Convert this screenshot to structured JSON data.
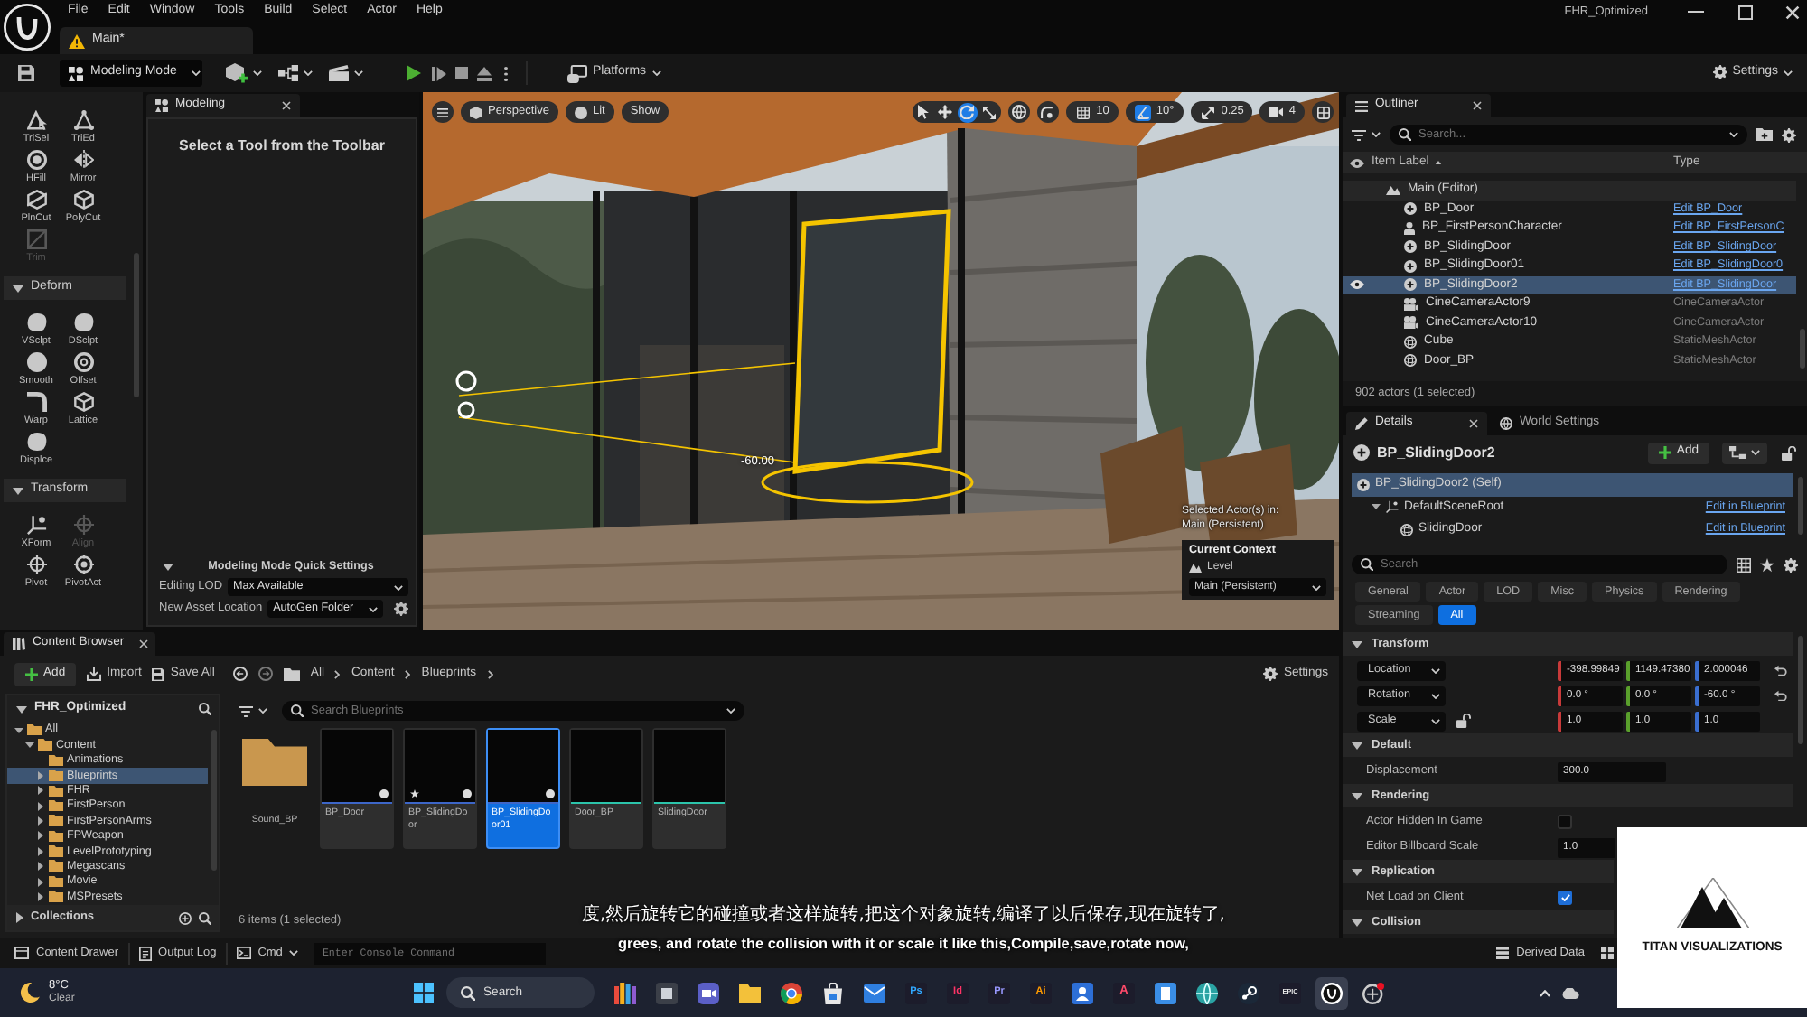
{
  "window": {
    "title": "FHR_Optimized"
  },
  "menu": [
    "File",
    "Edit",
    "Window",
    "Tools",
    "Build",
    "Select",
    "Actor",
    "Help"
  ],
  "level_tab": {
    "label": "Main*"
  },
  "toolbar": {
    "mode": "Modeling Mode",
    "platforms": "Platforms",
    "settings": "Settings"
  },
  "tool_palette": [
    {
      "items": [
        {
          "label": "TriSel",
          "disabled": false
        },
        {
          "label": "TriEd",
          "disabled": false
        },
        {
          "label": "HFill",
          "disabled": false
        },
        {
          "label": "Mirror",
          "disabled": false
        },
        {
          "label": "PlnCut",
          "disabled": false
        },
        {
          "label": "PolyCut",
          "disabled": false
        },
        {
          "label": "Trim",
          "disabled": true
        }
      ]
    },
    {
      "title": "Deform",
      "expanded": true,
      "items": [
        {
          "label": "VSclpt",
          "disabled": false
        },
        {
          "label": "DSclpt",
          "disabled": false
        },
        {
          "label": "Smooth",
          "disabled": false
        },
        {
          "label": "Offset",
          "disabled": false
        },
        {
          "label": "Warp",
          "disabled": false
        },
        {
          "label": "Lattice",
          "disabled": false
        },
        {
          "label": "Displce",
          "disabled": false
        }
      ]
    },
    {
      "title": "Transform",
      "expanded": true,
      "items": [
        {
          "label": "XForm",
          "disabled": false
        },
        {
          "label": "Align",
          "disabled": true
        },
        {
          "label": "Pivot",
          "disabled": false
        },
        {
          "label": "PivotAct",
          "disabled": false
        }
      ]
    }
  ],
  "modeling_panel": {
    "tab": "Modeling",
    "message": "Select a Tool from the Toolbar",
    "quick_settings": {
      "title": "Modeling Mode Quick Settings",
      "expanded": true,
      "fields": [
        {
          "label": "Editing LOD",
          "value": "Max Available"
        },
        {
          "label": "New Asset Location",
          "value": "AutoGen Folder"
        }
      ]
    }
  },
  "viewport": {
    "view_buttons": [
      "Perspective",
      "Lit",
      "Show"
    ],
    "transform_tools": [
      {
        "selected": false
      },
      {
        "selected": false
      },
      {
        "selected": true
      },
      {
        "selected": false
      }
    ],
    "snaps": [
      {
        "value": "10",
        "on": false
      },
      {
        "value": "10°",
        "on": true
      },
      {
        "value": "0.25",
        "on": false
      }
    ],
    "camera_speed": "4",
    "gizmo_reading": "-60.00",
    "context": {
      "selection_note": "Selected Actor(s) in:",
      "selection_level": "Main (Persistent)",
      "title": "Current Context",
      "level_label": "Level",
      "level": "Main (Persistent)"
    }
  },
  "outliner": {
    "tab": "Outliner",
    "search_placeholder": "Search...",
    "columns": [
      "Item Label",
      "Type"
    ],
    "tree": [
      {
        "label": "Main (Editor)",
        "selected": false,
        "children": [
          {
            "label": "BP_Door",
            "type": "Edit BP_Door",
            "kind": "blueprint",
            "selected": false
          },
          {
            "label": "BP_FirstPersonCharacter",
            "type": "Edit BP_FirstPersonC",
            "kind": "character",
            "selected": false
          },
          {
            "label": "BP_SlidingDoor",
            "type": "Edit BP_SlidingDoor",
            "kind": "blueprint",
            "selected": false
          },
          {
            "label": "BP_SlidingDoor01",
            "type": "Edit BP_SlidingDoor0",
            "kind": "blueprint",
            "selected": false
          },
          {
            "label": "BP_SlidingDoor2",
            "type": "Edit BP_SlidingDoor",
            "kind": "blueprint",
            "selected": true
          },
          {
            "label": "CineCameraActor9",
            "type": "CineCameraActor",
            "kind": "camera",
            "selected": false
          },
          {
            "label": "CineCameraActor10",
            "type": "CineCameraActor",
            "kind": "camera",
            "selected": false
          },
          {
            "label": "Cube",
            "type": "StaticMeshActor",
            "kind": "mesh",
            "selected": false
          },
          {
            "label": "Door_BP",
            "type": "StaticMeshActor",
            "kind": "mesh",
            "selected": false
          }
        ]
      }
    ],
    "footer": "902 actors (1 selected)"
  },
  "details": {
    "tabs": [
      {
        "label": "Details",
        "selected": true
      },
      {
        "label": "World Settings",
        "selected": false
      }
    ],
    "actor": "BP_SlidingDoor2",
    "add_button": "Add",
    "components": [
      {
        "label": "BP_SlidingDoor2 (Self)",
        "selected": true,
        "children": [
          {
            "label": "DefaultSceneRoot",
            "link": "Edit in Blueprint",
            "selected": false,
            "children": [
              {
                "label": "SlidingDoor",
                "link": "Edit in Blueprint",
                "selected": false
              }
            ]
          }
        ]
      }
    ],
    "search_placeholder": "Search",
    "filters": [
      {
        "label": "General",
        "selected": false
      },
      {
        "label": "Actor",
        "selected": false
      },
      {
        "label": "LOD",
        "selected": false
      },
      {
        "label": "Misc",
        "selected": false
      },
      {
        "label": "Physics",
        "selected": false
      },
      {
        "label": "Rendering",
        "selected": false
      },
      {
        "label": "Streaming",
        "selected": false
      },
      {
        "label": "All",
        "selected": true
      }
    ],
    "sections": [
      {
        "title": "Transform",
        "expanded": true,
        "rows": [
          {
            "kind": "vector",
            "label": "Location",
            "values": [
              "-398.99849",
              "1149.47380",
              "2.000046"
            ],
            "modified": true
          },
          {
            "kind": "vector",
            "label": "Rotation",
            "values": [
              "0.0 °",
              "0.0 °",
              "-60.0 °"
            ],
            "modified": true
          },
          {
            "kind": "scale",
            "label": "Scale",
            "values": [
              "1.0",
              "1.0",
              "1.0"
            ],
            "modified": false,
            "locked": false
          }
        ]
      },
      {
        "title": "Default",
        "expanded": true,
        "rows": [
          {
            "kind": "number",
            "label": "Displacement",
            "value": "300.0"
          }
        ]
      },
      {
        "title": "Rendering",
        "expanded": true,
        "rows": [
          {
            "kind": "checkbox",
            "label": "Actor Hidden In Game",
            "checked": false
          },
          {
            "kind": "number",
            "label": "Editor Billboard Scale",
            "value": "1.0"
          }
        ]
      },
      {
        "title": "Replication",
        "expanded": true,
        "rows": [
          {
            "kind": "checkbox",
            "label": "Net Load on Client",
            "checked": true
          }
        ]
      },
      {
        "title": "Collision",
        "expanded": true
      }
    ]
  },
  "content_browser": {
    "tab": "Content Browser",
    "buttons": [
      "Add",
      "Import",
      "Save All"
    ],
    "breadcrumbs": [
      "All",
      "Content",
      "Blueprints"
    ],
    "settings": "Settings",
    "tree_title": "FHR_Optimized",
    "folders": [
      {
        "label": "All",
        "expanded": true,
        "selected": false,
        "children": [
          {
            "label": "Content",
            "expanded": true,
            "selected": false,
            "children": [
              {
                "label": "Animations",
                "selected": false
              },
              {
                "label": "Blueprints",
                "expanded": false,
                "selected": true
              },
              {
                "label": "FHR",
                "expanded": false,
                "selected": false
              },
              {
                "label": "FirstPerson",
                "expanded": false,
                "selected": false
              },
              {
                "label": "FirstPersonArms",
                "expanded": false,
                "selected": false
              },
              {
                "label": "FPWeapon",
                "expanded": false,
                "selected": false
              },
              {
                "label": "LevelPrototyping",
                "expanded": false,
                "selected": false
              },
              {
                "label": "Megascans",
                "expanded": false,
                "selected": false
              },
              {
                "label": "Movie",
                "expanded": false,
                "selected": false
              },
              {
                "label": "MSPresets",
                "expanded": false,
                "selected": false
              }
            ]
          }
        ]
      }
    ],
    "collections": "Collections",
    "search_placeholder": "Search Blueprints",
    "assets": [
      {
        "name": "Sound_BP",
        "kind": "folder",
        "selected": false,
        "starred": false
      },
      {
        "name": "BP_Door",
        "kind": "blueprint",
        "selected": false,
        "starred": false
      },
      {
        "name": "BP_SlidingDoor",
        "kind": "blueprint",
        "selected": false,
        "starred": true
      },
      {
        "name": "BP_SlidingDoor01",
        "kind": "blueprint",
        "selected": true,
        "starred": false
      },
      {
        "name": "Door_BP",
        "kind": "mesh",
        "selected": false,
        "starred": false
      },
      {
        "name": "SlidingDoor",
        "kind": "mesh",
        "selected": false,
        "starred": false
      }
    ],
    "footer": "6 items (1 selected)"
  },
  "status_bar": {
    "items": [
      "Content Drawer",
      "Output Log"
    ],
    "cmd": "Cmd",
    "console_placeholder": "Enter Console Command",
    "derived_data": "Derived Data"
  },
  "taskbar": {
    "weather": {
      "temperature": "8°C",
      "condition": "Clear"
    },
    "search_placeholder": "Search",
    "apps": [
      {
        "kind": "pencils",
        "selected": false
      },
      {
        "kind": "gallery",
        "selected": false
      },
      {
        "kind": "video",
        "selected": false
      },
      {
        "kind": "folder",
        "selected": false
      },
      {
        "kind": "browser",
        "selected": false
      },
      {
        "kind": "store",
        "selected": false
      },
      {
        "kind": "mail",
        "selected": false
      },
      {
        "kind": "letters",
        "glyph": "Ps",
        "color": "#31a8ff",
        "selected": false
      },
      {
        "kind": "letters",
        "glyph": "Id",
        "color": "#ff3366",
        "selected": false
      },
      {
        "kind": "letters",
        "glyph": "Pr",
        "color": "#9999ff",
        "selected": false
      },
      {
        "kind": "letters",
        "glyph": "Ai",
        "color": "#ff9a00",
        "selected": false
      },
      {
        "kind": "person",
        "selected": false
      },
      {
        "kind": "letters",
        "glyph": "A",
        "color": "#ff4a6a",
        "selected": false
      },
      {
        "kind": "document",
        "selected": false
      },
      {
        "kind": "globe",
        "selected": false
      },
      {
        "kind": "valve",
        "selected": false
      },
      {
        "kind": "letters",
        "glyph": "EPIC",
        "color": "#e8e8e8",
        "selected": false
      },
      {
        "kind": "ring",
        "selected": true
      },
      {
        "kind": "orb",
        "selected": false
      }
    ]
  },
  "subtitles": [
    "度,然后旋转它的碰撞或者这样旋转,把这个对象旋转,编译了以后保存,现在旋转了,",
    "grees, and rotate the collision with it or scale it like this,Compile,save,rotate now,"
  ],
  "channel_logo": {
    "text": "TITAN VISUALIZATIONS"
  }
}
